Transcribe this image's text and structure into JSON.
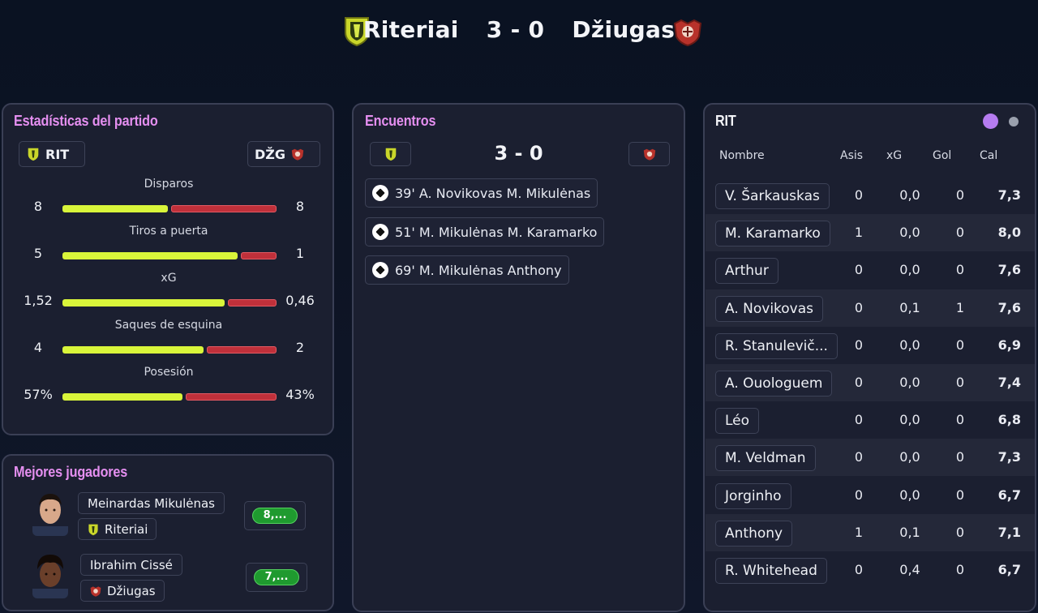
{
  "match": {
    "home_team": "Riteriai",
    "away_team": "Džiugas",
    "score": "3 - 0",
    "home_short": "RIT",
    "away_short": "DŽG"
  },
  "stats_panel": {
    "title": "Estadísticas del partido",
    "rows": [
      {
        "label": "Disparos",
        "home": "8",
        "away": "8",
        "home_share": 0.5
      },
      {
        "label": "Tiros a puerta",
        "home": "5",
        "away": "1",
        "home_share": 0.83
      },
      {
        "label": "xG",
        "home": "1,52",
        "away": "0,46",
        "home_share": 0.77
      },
      {
        "label": "Saques de esquina",
        "home": "4",
        "away": "2",
        "home_share": 0.67
      },
      {
        "label": "Posesión",
        "home": "57%",
        "away": "43%",
        "home_share": 0.57
      }
    ]
  },
  "encounters": {
    "title": "Encuentros",
    "score": "3 - 0",
    "goals": [
      {
        "text": "39' A. Novikovas M. Mikulėnas"
      },
      {
        "text": "51' M. Mikulėnas M. Karamarko"
      },
      {
        "text": "69' M. Mikulėnas Anthony"
      }
    ]
  },
  "best_players": {
    "title": "Mejores jugadores",
    "players": [
      {
        "name": "Meinardas Mikulėnas",
        "team": "Riteriai",
        "rating": "8,..."
      },
      {
        "name": "Ibrahim Cissé",
        "team": "Džiugas",
        "rating": "7,..."
      }
    ]
  },
  "lineup": {
    "team": "RIT",
    "headers": {
      "name": "Nombre",
      "assists": "Asis",
      "xg": "xG",
      "goals": "Gol",
      "rating": "Cal"
    },
    "players": [
      {
        "name": "V. Šarkauskas",
        "assists": "0",
        "xg": "0,0",
        "goals": "0",
        "rating": "7,3"
      },
      {
        "name": "M. Karamarko",
        "assists": "1",
        "xg": "0,0",
        "goals": "0",
        "rating": "8,0"
      },
      {
        "name": "Arthur",
        "assists": "0",
        "xg": "0,0",
        "goals": "0",
        "rating": "7,6"
      },
      {
        "name": "A. Novikovas",
        "assists": "0",
        "xg": "0,1",
        "goals": "1",
        "rating": "7,6"
      },
      {
        "name": "R. Stanulevič...",
        "assists": "0",
        "xg": "0,0",
        "goals": "0",
        "rating": "6,9"
      },
      {
        "name": "A. Ouologuem",
        "assists": "0",
        "xg": "0,0",
        "goals": "0",
        "rating": "7,4"
      },
      {
        "name": "Léo",
        "assists": "0",
        "xg": "0,0",
        "goals": "0",
        "rating": "6,8"
      },
      {
        "name": "M. Veldman",
        "assists": "0",
        "xg": "0,0",
        "goals": "0",
        "rating": "7,3"
      },
      {
        "name": "Jorginho",
        "assists": "0",
        "xg": "0,0",
        "goals": "0",
        "rating": "6,7"
      },
      {
        "name": "Anthony",
        "assists": "1",
        "xg": "0,1",
        "goals": "0",
        "rating": "7,1"
      },
      {
        "name": "R. Whitehead",
        "assists": "0",
        "xg": "0,4",
        "goals": "0",
        "rating": "6,7"
      }
    ]
  },
  "colors": {
    "home_bar": "#d9f53a",
    "away_bar": "#c0303a",
    "title_accent": "#e58ff0",
    "rating_pill": "#1f9a2f",
    "page_indicator_active": "#b67cf0",
    "page_indicator_inactive": "#9aa0ad"
  }
}
